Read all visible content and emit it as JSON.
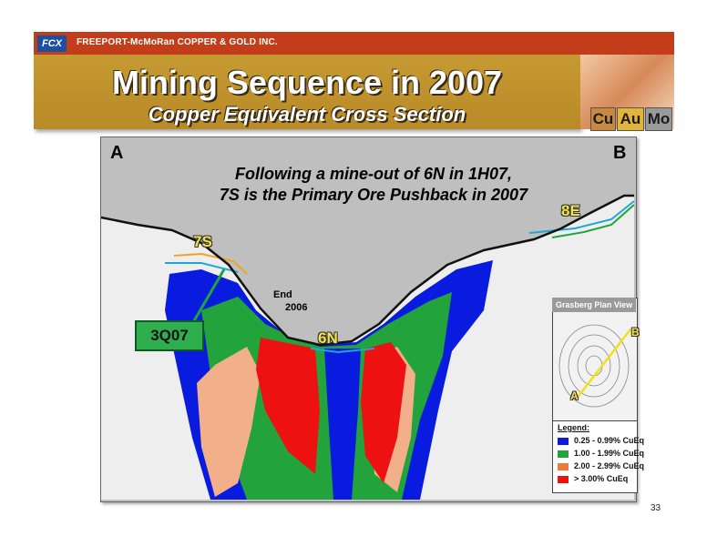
{
  "header": {
    "logo_text": "FCX",
    "company": "FREEPORT-McMoRan COPPER & GOLD INC.",
    "title": "Mining Sequence in 2007",
    "subtitle": "Copper Equivalent Cross Section",
    "elements": [
      "Cu",
      "Au",
      "Mo"
    ]
  },
  "section": {
    "label_a": "A",
    "label_b": "B",
    "caption_line1": "Following a mine-out of 6N in 1H07,",
    "caption_line2": "7S is the Primary Ore Pushback in 2007",
    "label_8e": "8E",
    "label_7s": "7S",
    "label_6n": "6N",
    "label_end": "End",
    "label_end_year": "2006",
    "label_3q07": "3Q07"
  },
  "plan_view": {
    "title": "Grasberg Plan View",
    "label_a": "A",
    "label_b": "B"
  },
  "legend": {
    "title": "Legend:",
    "items": [
      {
        "label": "0.25 - 0.99%  CuEq",
        "color": "#0a1be0"
      },
      {
        "label": "1.00 - 1.99%  CuEq",
        "color": "#22a33c"
      },
      {
        "label": "2.00 - 2.99%  CuEq",
        "color": "#f07a3a"
      },
      {
        "label": "> 3.00%  CuEq",
        "color": "#ee1111"
      }
    ]
  },
  "colors": {
    "blue": "#0a1be0",
    "green": "#22a33c",
    "peach": "#f2b08a",
    "red": "#ee1111",
    "sky": "#bfbfbf"
  },
  "page_number": "33"
}
